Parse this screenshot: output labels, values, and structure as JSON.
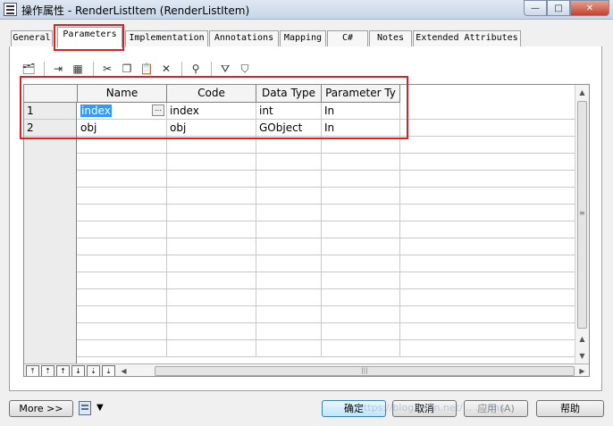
{
  "window": {
    "title": "操作属性 - RenderListItem (RenderListItem)",
    "minimize": "—",
    "maximize": "□",
    "close": "✕"
  },
  "tabs": [
    {
      "label": "General",
      "active": false
    },
    {
      "label": "Parameters",
      "active": true
    },
    {
      "label": "Implementation",
      "active": false
    },
    {
      "label": "Annotations",
      "active": false
    },
    {
      "label": "Mapping",
      "active": false
    },
    {
      "label": "C#",
      "active": false
    },
    {
      "label": "Notes",
      "active": false
    },
    {
      "label": "Extended Attributes",
      "active": false
    }
  ],
  "toolbar": {
    "icons": [
      "properties-icon",
      "insert-row-icon",
      "add-row-icon",
      "cut-icon",
      "copy-icon",
      "paste-icon",
      "delete-icon",
      "find-icon",
      "filter-icon",
      "clear-filter-icon"
    ]
  },
  "grid": {
    "columns": [
      "Name",
      "Code",
      "Data Type",
      "Parameter Ty"
    ],
    "rows": [
      {
        "num": "1",
        "name": "index",
        "code": "index",
        "data_type": "int",
        "param_type": "In"
      },
      {
        "num": "2",
        "name": "obj",
        "code": "obj",
        "data_type": "GObject",
        "param_type": "In"
      }
    ],
    "h_thumb_grip": "|||",
    "v_thumb_grip": "≡"
  },
  "buttons": {
    "more": "More >>",
    "ok": "确定",
    "cancel": "取消",
    "apply": "应用 (A)",
    "help": "帮助"
  },
  "watermark": "https://blog.csdn.net/... ...ions"
}
